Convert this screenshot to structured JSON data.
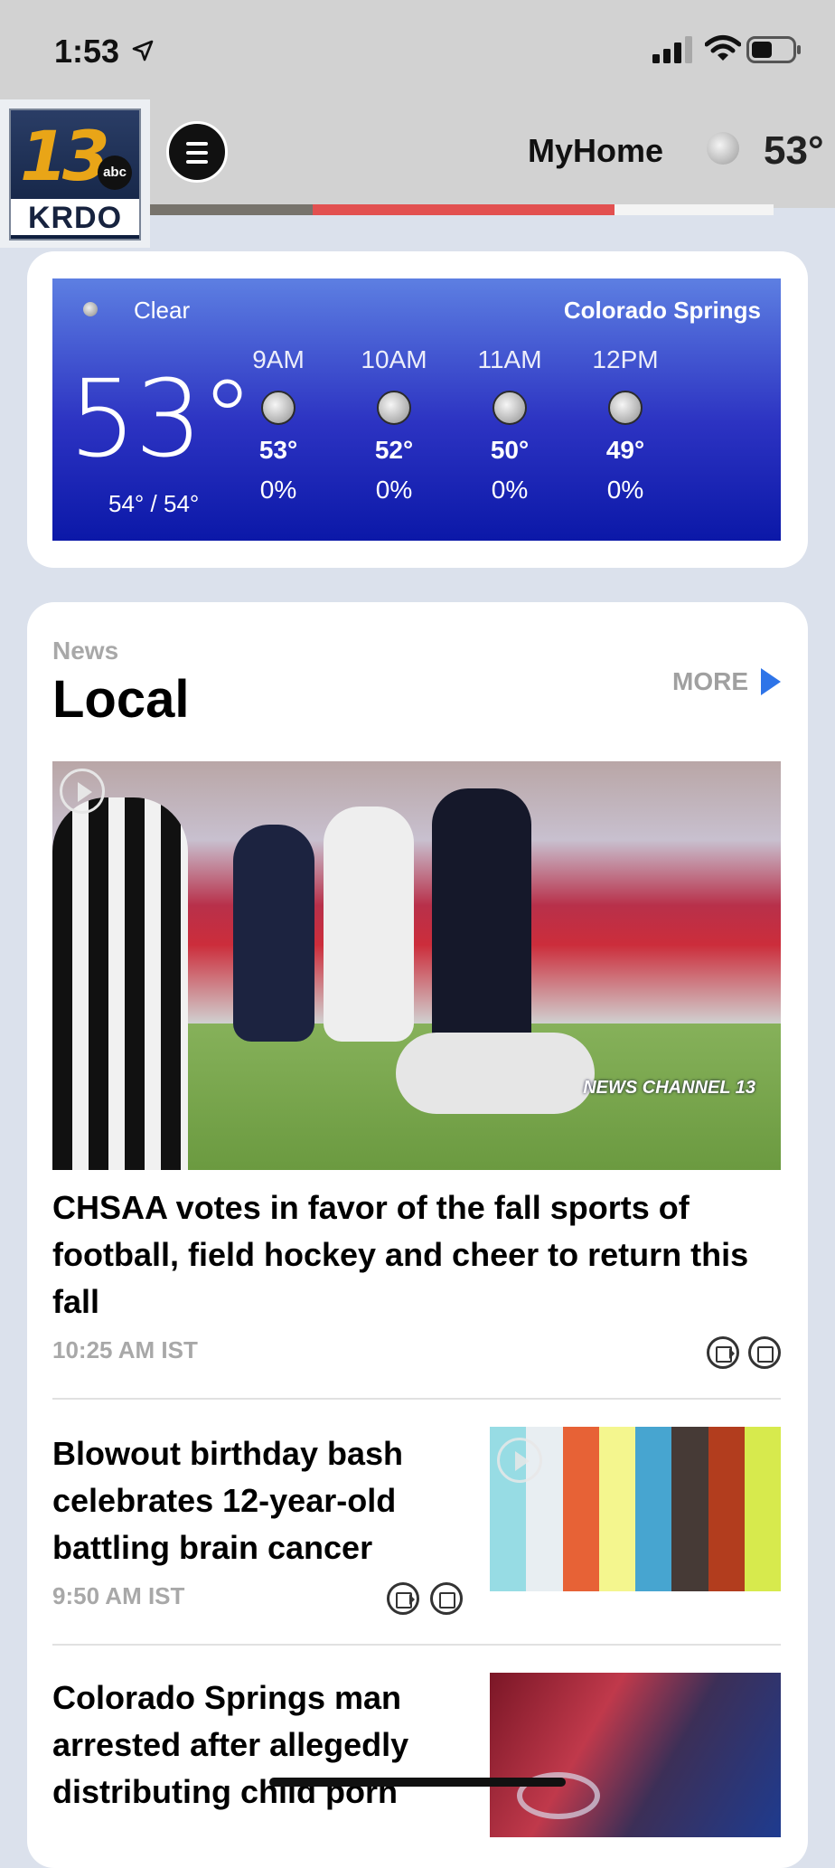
{
  "status_bar": {
    "time": "1:53"
  },
  "header": {
    "logo": {
      "number": "13",
      "network": "abc",
      "call_sign": "KRDO"
    },
    "myhome_label": "MyHome",
    "temp": "53°"
  },
  "weather": {
    "condition": "Clear",
    "city": "Colorado Springs",
    "current_temp": "53°",
    "hi_lo": "54° / 54°",
    "forecast": [
      {
        "time": "9AM",
        "temp": "53°",
        "precip": "0%"
      },
      {
        "time": "10AM",
        "temp": "52°",
        "precip": "0%"
      },
      {
        "time": "11AM",
        "temp": "50°",
        "precip": "0%"
      },
      {
        "time": "12PM",
        "temp": "49°",
        "precip": "0%"
      }
    ]
  },
  "news": {
    "kicker": "News",
    "title": "Local",
    "more_label": "MORE",
    "hero": {
      "watermark": "NEWS CHANNEL 13",
      "headline": "CHSAA votes in favor of the fall sports of football, field hockey and cheer to return this fall",
      "time": "10:25 AM IST"
    },
    "stories": [
      {
        "headline": "Blowout birthday bash celebrates 12-year-old battling brain cancer",
        "time": "9:50 AM IST"
      },
      {
        "headline": "Colorado Springs man arrested after allegedly distributing child porn"
      }
    ]
  }
}
